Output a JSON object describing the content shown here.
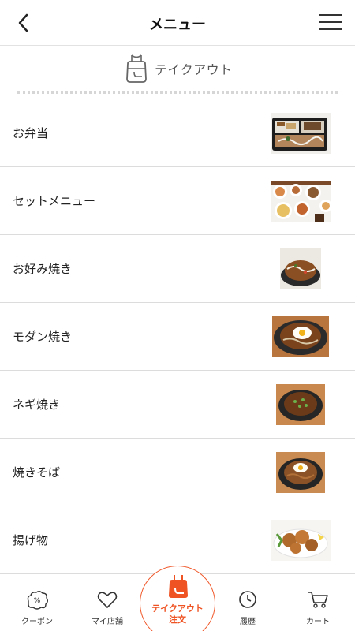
{
  "header": {
    "title": "メニュー",
    "back_icon": "chevron-left-icon",
    "menu_icon": "hamburger-menu-icon"
  },
  "section": {
    "label": "テイクアウト",
    "icon": "takeout-bag-icon"
  },
  "menu": {
    "items": [
      {
        "label": "お弁当"
      },
      {
        "label": "セットメニュー"
      },
      {
        "label": "お好み焼き"
      },
      {
        "label": "モダン焼き"
      },
      {
        "label": "ネギ焼き"
      },
      {
        "label": "焼きそば"
      },
      {
        "label": "揚げ物"
      }
    ]
  },
  "nav": {
    "coupon": "クーポン",
    "my_store": "マイ店舗",
    "takeout_line1": "テイクアウト",
    "takeout_line2": "注文",
    "history": "履歴",
    "cart": "カート"
  },
  "colors": {
    "accent": "#ef5323",
    "divider": "#dcdcdc"
  }
}
